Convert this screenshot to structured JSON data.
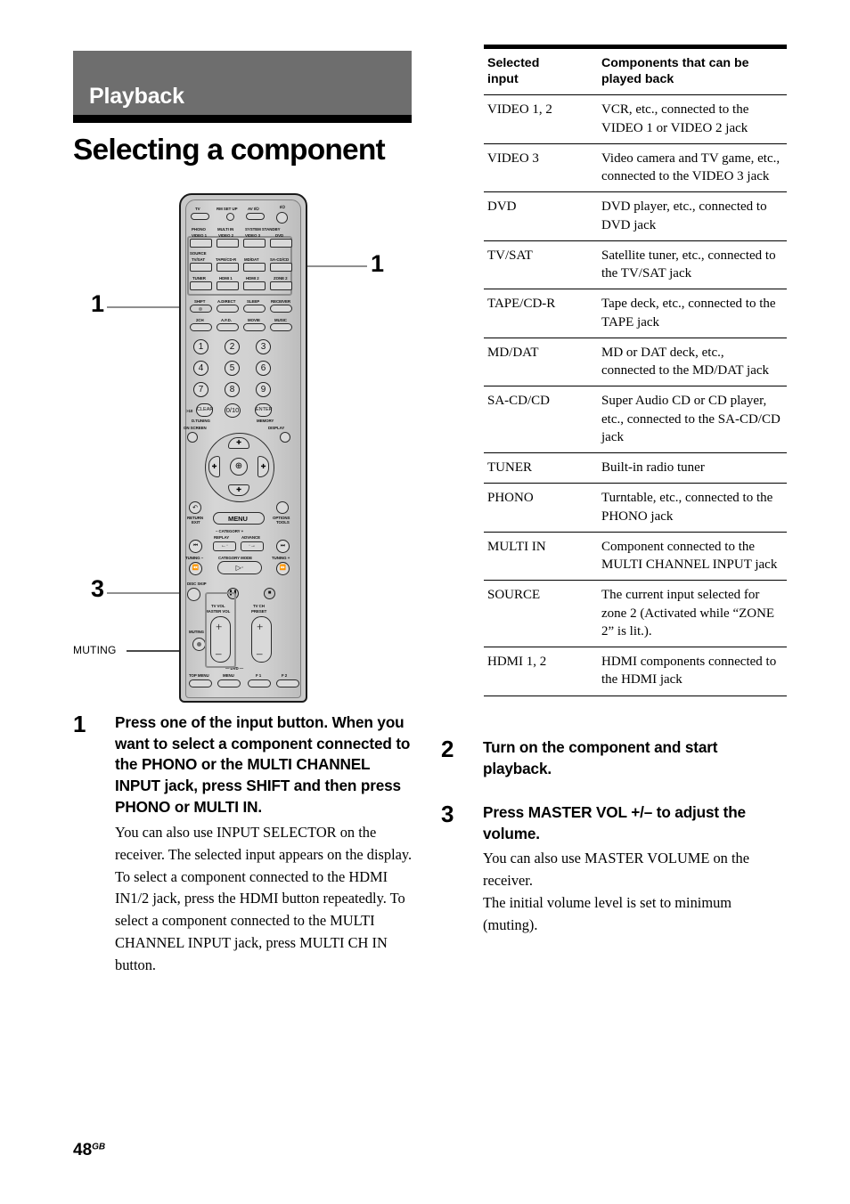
{
  "chapter": {
    "label": "Playback"
  },
  "title": "Selecting a component",
  "footer": {
    "page_number": "48",
    "suffix": "GB"
  },
  "callouts": {
    "input_group": "1",
    "shift": "1",
    "master_vol": "3",
    "muting": "MUTING"
  },
  "remote": {
    "top_row": [
      "TV",
      "RM SET UP",
      "AV I/⏻",
      "I/⏻"
    ],
    "standby_label": "SYSTEM STANDBY",
    "shift_row_upper": [
      "PHONO",
      "MULTI IN",
      "",
      ""
    ],
    "input_row1": [
      "VIDEO 1",
      "VIDEO 2",
      "VIDEO 3",
      "DVD"
    ],
    "source_label": "SOURCE",
    "input_row2": [
      "TV/SAT",
      "TAPE/CD-R",
      "MD/DAT",
      "SA-CD/CD"
    ],
    "input_row3": [
      "TUNER",
      "HDMI 1",
      "HDMI 2",
      "ZONE 2"
    ],
    "mode_row1": [
      "SHIFT",
      "A.DIRECT",
      "SLEEP",
      "RECEIVER"
    ],
    "mode_row2": [
      "2CH",
      "A.F.D.",
      "MOVIE",
      "MUSIC"
    ],
    "numbers": [
      "1",
      "2",
      "3",
      "4",
      "5",
      "6",
      "7",
      "8",
      "9"
    ],
    "num_row4": [
      ">10",
      "CLEAR",
      "0/10",
      "ENTER"
    ],
    "num_row4_sub": [
      "D.TUNING",
      "MEMORY"
    ],
    "screen_row": [
      "ON SCREEN",
      "DISPLAY"
    ],
    "nav_center": "⊕",
    "menu_row": [
      "RETURN\nEXIT",
      "MENU",
      "OPTIONS\nTOOLS"
    ],
    "category_label": "–  CATEGORY  +",
    "replay_advance": [
      "REPLAY",
      "ADVANCE"
    ],
    "tuning_row": [
      "TUNING –",
      "CATEGORY MODE",
      "TUNING +"
    ],
    "disc_skip": "DISC SKIP",
    "vol_labels": [
      "TV VOL",
      "MASTER VOL"
    ],
    "ch_labels": [
      "TV CH",
      "PRESET"
    ],
    "muting": "MUTING",
    "dvd_label": "DVD",
    "bottom_row": [
      "TOP MENU",
      "MENU",
      "F 1",
      "F 2"
    ]
  },
  "table": {
    "headers": [
      "Selected input",
      "Components that can be played back"
    ],
    "header_line1_a": "Selected",
    "header_line2_a": "input",
    "header_line1_b": "Components that can be",
    "header_line2_b": "played back",
    "rows": [
      {
        "input": "VIDEO 1, 2",
        "components": "VCR, etc., connected to the VIDEO 1 or VIDEO 2 jack"
      },
      {
        "input": "VIDEO 3",
        "components": "Video camera and TV game, etc., connected to the VIDEO 3 jack"
      },
      {
        "input": "DVD",
        "components": "DVD player, etc., connected to DVD jack"
      },
      {
        "input": "TV/SAT",
        "components": "Satellite tuner, etc., connected to the TV/SAT jack"
      },
      {
        "input": "TAPE/CD-R",
        "components": "Tape deck, etc., connected to the TAPE jack"
      },
      {
        "input": "MD/DAT",
        "components": "MD or DAT deck, etc., connected to the MD/DAT jack"
      },
      {
        "input": "SA-CD/CD",
        "components": "Super Audio CD or CD player, etc., connected to the SA-CD/CD jack"
      },
      {
        "input": "TUNER",
        "components": "Built-in radio tuner"
      },
      {
        "input": "PHONO",
        "components": "Turntable, etc., connected to the PHONO jack"
      },
      {
        "input": "MULTI IN",
        "components": "Component connected to the MULTI CHANNEL INPUT jack"
      },
      {
        "input": "SOURCE",
        "components": "The current input selected for zone 2 (Activated while “ZONE 2” is lit.)."
      },
      {
        "input": "HDMI 1, 2",
        "components": "HDMI components connected to the HDMI jack"
      }
    ]
  },
  "steps": [
    {
      "num": "1",
      "heading": "Press one of the input button. When you want to select a component connected to the PHONO or the MULTI CHANNEL INPUT jack, press SHIFT and then press PHONO or MULTI IN.",
      "body": "You can also use INPUT SELECTOR on the receiver. The selected input appears on the display. To select a component connected to the HDMI IN1/2 jack, press the HDMI button repeatedly. To select a component connected to the MULTI CHANNEL INPUT jack, press MULTI CH IN button."
    },
    {
      "num": "2",
      "heading": "Turn on the component and start playback.",
      "body": ""
    },
    {
      "num": "3",
      "heading": "Press MASTER VOL +/– to adjust the volume.",
      "body": "You can also use MASTER VOLUME on the receiver.\nThe initial volume level is set to minimum (muting)."
    }
  ]
}
